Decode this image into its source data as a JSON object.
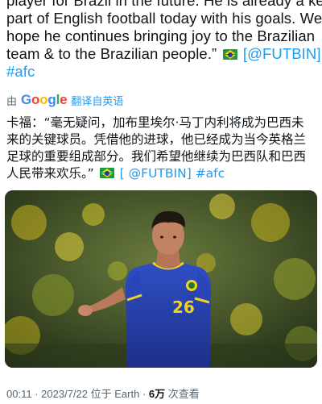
{
  "tweet": {
    "lines": [
      "player for Brazil in the future. He is already a key",
      "part of English football today with his goals. We",
      "hope he continues bringing joy to the Brazilian",
      "team & to the Brazilian people.”"
    ],
    "bracket_open": "[",
    "mention": "@FUTBIN",
    "bracket_close": "]",
    "hashtag": "#afc"
  },
  "translation": {
    "by": "由",
    "provider": "Google",
    "action": "翻译自英语"
  },
  "translated": {
    "lines": [
      "卡福：“毫无疑问，加布里埃尔·马丁内利将成为巴西未",
      "来的关键球员。凭借他的进球，他已经成为当今英格兰",
      "足球的重要组成部分。我们希望他继续为巴西队和巴西",
      "人民带来欢乐。”"
    ],
    "bracket_open": "[",
    "mention": "@FUTBIN",
    "bracket_close": "]",
    "hashtag": "#afc"
  },
  "photo": {
    "jersey_number": "26",
    "colors": {
      "jersey": "#2a45b8",
      "jersey_trim": "#f2d21a",
      "background": "#3b4a2a"
    }
  },
  "meta": {
    "time": "00:11",
    "sep": "·",
    "date": "2023/7/22",
    "location": "位于 Earth",
    "views_count": "6万",
    "views_label": "次查看"
  },
  "colors": {
    "link": "#1d9bf0",
    "muted": "#536471",
    "text": "#0f1419"
  },
  "icons": [
    "brazil-flag-icon"
  ]
}
